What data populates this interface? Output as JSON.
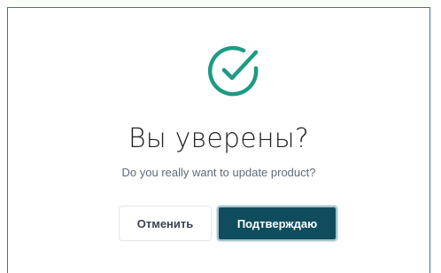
{
  "dialog": {
    "icon": "check-circle-icon",
    "title": "Вы уверены?",
    "message": "Do you really want to update product?",
    "cancel_label": "Отменить",
    "confirm_label": "Подтверждаю"
  },
  "colors": {
    "accent": "#1e9b84",
    "primary_button": "#0f4d5e",
    "frame_border": "#3f6fa8"
  }
}
